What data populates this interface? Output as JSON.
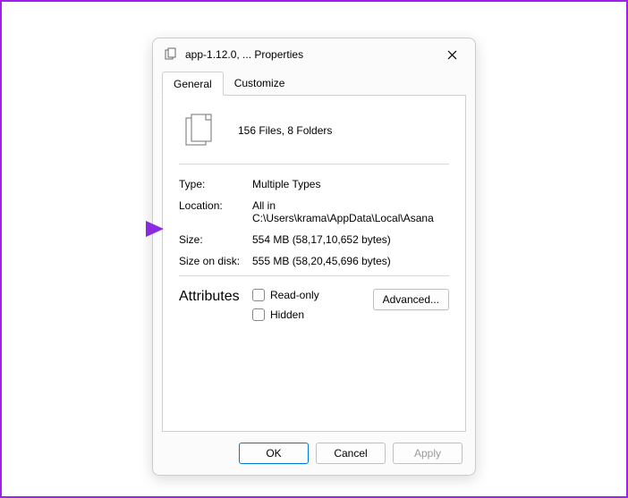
{
  "title": "app-1.12.0, ... Properties",
  "tabs": {
    "general": "General",
    "customize": "Customize"
  },
  "summary": "156 Files, 8 Folders",
  "props": {
    "type_label": "Type:",
    "type_value": "Multiple Types",
    "location_label": "Location:",
    "location_value": "All in C:\\Users\\krama\\AppData\\Local\\Asana",
    "size_label": "Size:",
    "size_value": "554 MB (58,17,10,652 bytes)",
    "disk_label": "Size on disk:",
    "disk_value": "555 MB (58,20,45,696 bytes)"
  },
  "attributes": {
    "label": "Attributes",
    "readonly": "Read-only",
    "hidden": "Hidden",
    "advanced": "Advanced..."
  },
  "buttons": {
    "ok": "OK",
    "cancel": "Cancel",
    "apply": "Apply"
  }
}
